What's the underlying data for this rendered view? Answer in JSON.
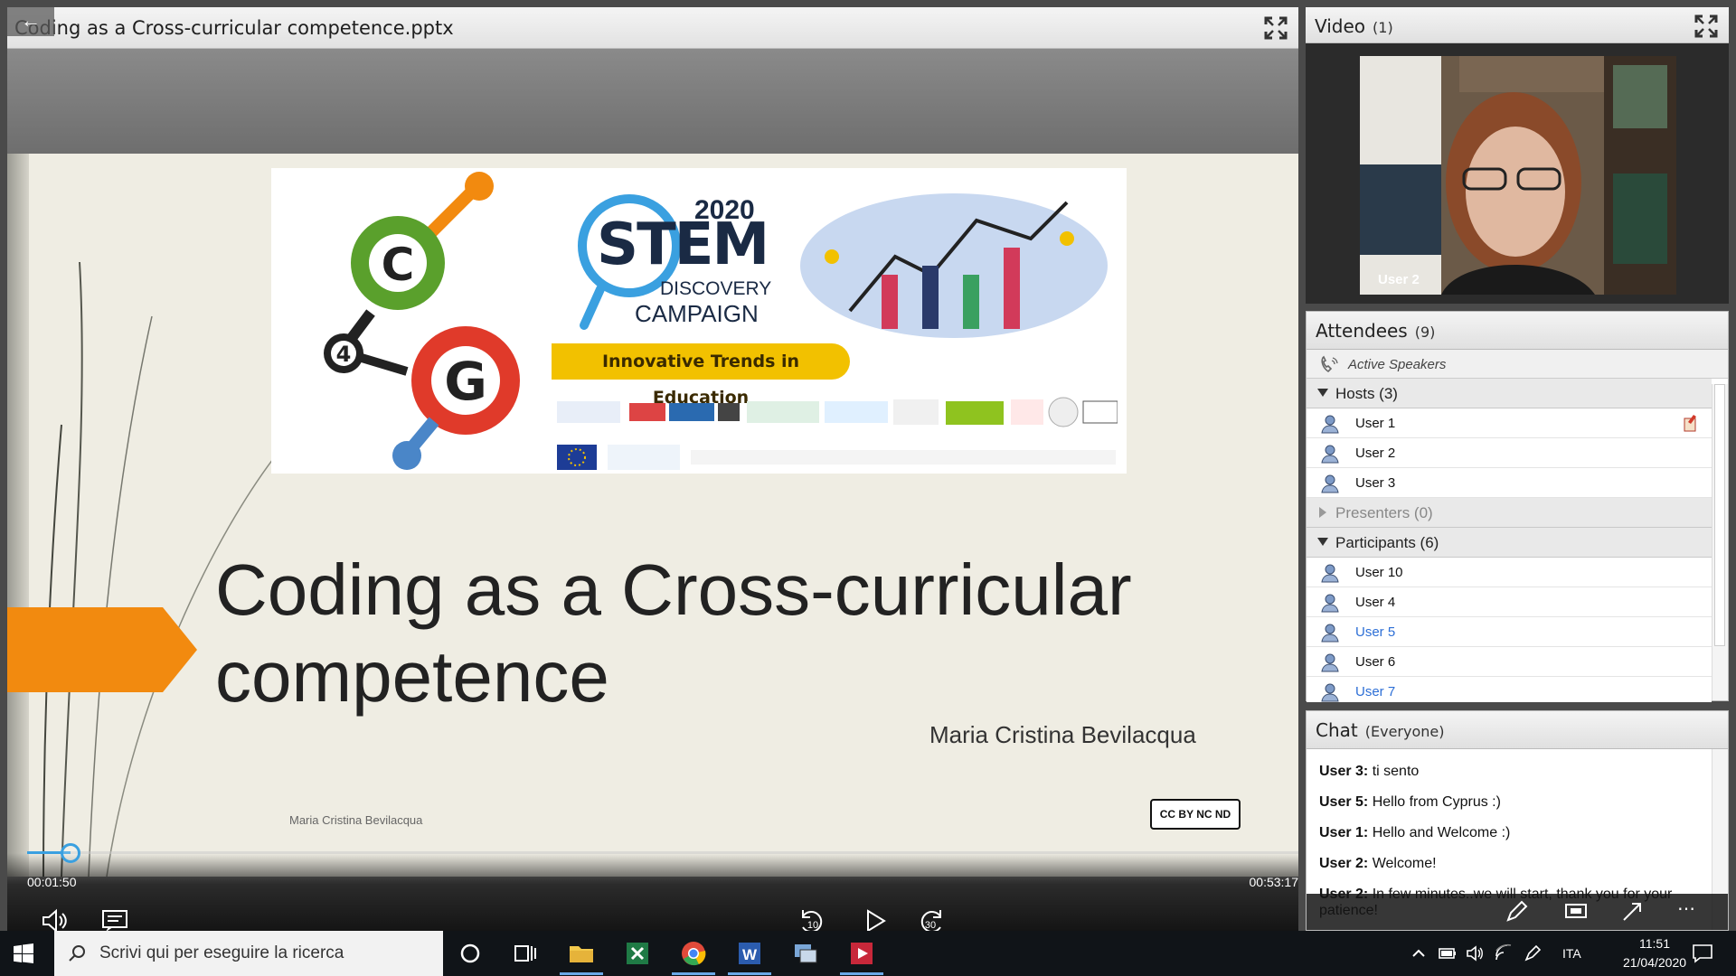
{
  "share_pod": {
    "title": "Coding as a Cross-curricular competence.pptx"
  },
  "slide": {
    "banner": {
      "year": "2020",
      "stem": "STEM",
      "discovery": "DISCOVERY",
      "campaign": "CAMPAIGN",
      "tagline": "Innovative Trends in Education",
      "logo_letters": [
        "C",
        "4",
        "G"
      ]
    },
    "title_line1": "Coding as a Cross-curricular",
    "title_line2": "competence",
    "author": "Maria Cristina Bevilacqua",
    "footer": "Maria Cristina Bevilacqua",
    "license_badge": "CC BY NC ND"
  },
  "player": {
    "elapsed": "00:01:50",
    "remaining": "00:53:17",
    "progress_fraction": 0.034,
    "rewind_label": "10",
    "forward_label": "30"
  },
  "video_pod": {
    "title": "Video",
    "count": "(1)",
    "user_label": "User 2"
  },
  "attendees": {
    "title": "Attendees",
    "count": "(9)",
    "active_speakers": "Active Speakers",
    "groups": [
      {
        "label": "Hosts (3)",
        "open": true,
        "users": [
          {
            "name": "User 1",
            "highlight": false,
            "badge": true
          },
          {
            "name": "User 2",
            "highlight": false,
            "badge": false
          },
          {
            "name": "User 3",
            "highlight": false,
            "badge": false
          }
        ]
      },
      {
        "label": "Presenters (0)",
        "open": false,
        "users": []
      },
      {
        "label": "Participants (6)",
        "open": true,
        "users": [
          {
            "name": "User 10",
            "highlight": false,
            "badge": false
          },
          {
            "name": "User 4",
            "highlight": false,
            "badge": false
          },
          {
            "name": "User 5",
            "highlight": true,
            "badge": false
          },
          {
            "name": "User 6",
            "highlight": false,
            "badge": false
          },
          {
            "name": "User 7",
            "highlight": true,
            "badge": false
          }
        ]
      }
    ]
  },
  "chat": {
    "title": "Chat",
    "scope": "(Everyone)",
    "messages": [
      {
        "user": "User 3:",
        "text": " ti sento"
      },
      {
        "user": "User 5:",
        "text": " Hello from Cyprus :)"
      },
      {
        "user": "User 1:",
        "text": " Hello and Welcome :)"
      },
      {
        "user": "User 2:",
        "text": " Welcome!"
      },
      {
        "user": "User 2:",
        "text": " In few minutes..we will start, thank you for your patience!"
      }
    ]
  },
  "taskbar": {
    "search_placeholder": "Scrivi qui per eseguire la ricerca",
    "language": "ITA",
    "time": "11:51",
    "date": "21/04/2020"
  },
  "colors": {
    "accent_blue": "#3aa0e0",
    "slide_orange": "#f28a0f",
    "tagline_yellow": "#f2c100",
    "highlight_user": "#2d6fd6"
  }
}
